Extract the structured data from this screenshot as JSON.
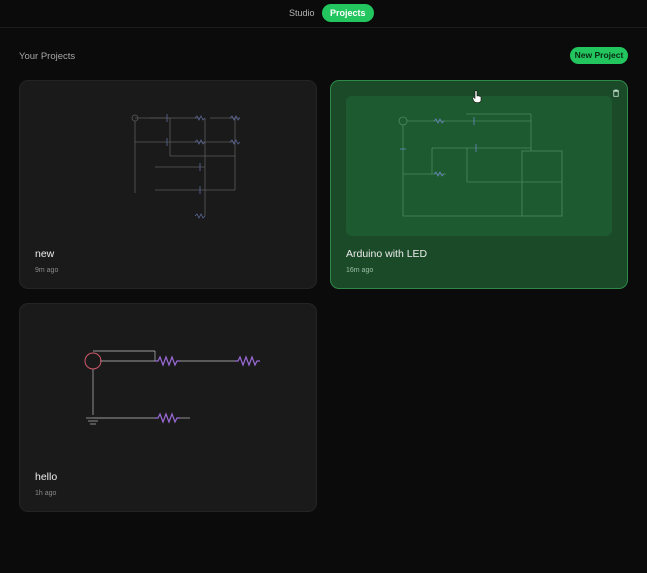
{
  "nav": {
    "tabs": [
      {
        "label": "Studio",
        "active": false
      },
      {
        "label": "Projects",
        "active": true
      }
    ]
  },
  "page": {
    "title": "Your Projects",
    "new_project_label": "New Project"
  },
  "projects": [
    {
      "name": "new",
      "time": "9m ago"
    },
    {
      "name": "Arduino with LED",
      "time": "16m ago"
    },
    {
      "name": "hello",
      "time": "1h ago"
    }
  ],
  "colors": {
    "accent": "#22c55e",
    "selected_card": "#1a4a28",
    "card": "#1a1a1a",
    "background": "#0b0b0b",
    "resistor": "#9b6bd8",
    "source": "#d05a6a",
    "wire": "#9a9a9a"
  },
  "icons": {
    "delete": "trash-icon",
    "cursor": "hand-pointer-icon"
  }
}
